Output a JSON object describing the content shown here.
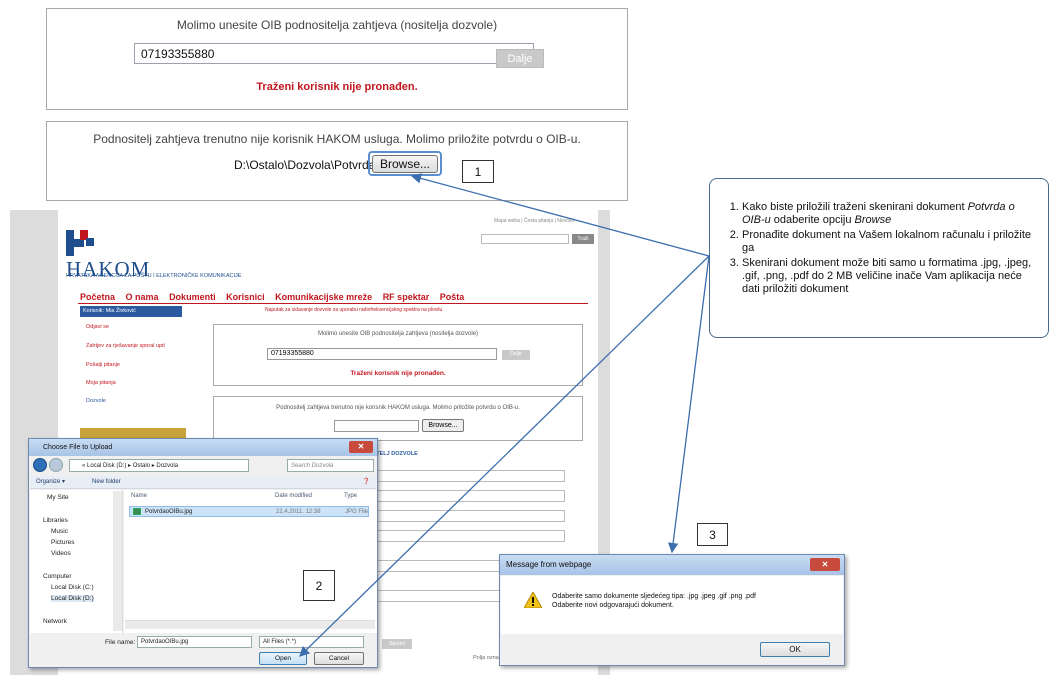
{
  "top_oib_panel": {
    "title": "Molimo unesite OIB podnositelja zahtjeva (nositelja dozvole)",
    "oib_value": "07193355880",
    "next_button": "Dalje",
    "error": "Traženi korisnik nije pronađen."
  },
  "top_upload_panel": {
    "title": "Podnositelj zahtjeva trenutno nije korisnik HAKOM usluga. Molimo priložite potvrdu o OIB-u.",
    "file_path": "D:\\Ostalo\\Dozvola\\Potvrda",
    "browse_button": "Browse..."
  },
  "callouts": {
    "one": "1",
    "two": "2",
    "three": "3"
  },
  "instructions": {
    "item1_a": "Kako biste priložili traženi skenirani dokument ",
    "item1_em": "Potvrda o OIB-u",
    "item1_b": " odaberite opciju ",
    "item1_em2": "Browse",
    "item2": "Pronađite dokument na Vašem lokalnom računalu i priložite ga",
    "item3": "Skenirani dokument može biti samo u formatima .jpg, .jpeg, .gif, .png, .pdf  do 2 MB veličine inače Vam aplikacija neće dati priložiti dokument"
  },
  "site": {
    "logo_text": "HAKOM",
    "logo_sub": "HRVATSKA AGENCIJA ZA POŠTU I ELEKTRONIČKE KOMUNIKACIJE",
    "top_links": "Mapa weba | Česta pitanja | Novosti",
    "search_button": "Traži",
    "nav": [
      "Početna",
      "O nama",
      "Dokumenti",
      "Korisnici",
      "Komunikacijske mreže",
      "RF spektar",
      "Pošta"
    ],
    "user_tab": "Korisnik: Mia Živković",
    "notice": "Naputak za izdavanje dozvole za uporabu radiofrekvencijskog spektra na plovilu",
    "side_links": [
      "Odjavi se",
      "Zahtjev za rješavanje sporal upit",
      "Pošalji pitanje",
      "Moja pitanja",
      "Dozvole"
    ],
    "form_heading": "HTJEVA/NOSITELJ DOZVOLE",
    "save_button": "Spremi",
    "footer": "Polja ozna"
  },
  "file_dialog": {
    "title": "Choose File to Upload",
    "address": "« Local Disk (D:) ▸ Ostalo ▸ Dozvola",
    "search_placeholder": "Search Dozvola",
    "organize": "Organize ▾",
    "new_folder": "New folder",
    "tree": [
      "My Site",
      "Libraries",
      "Music",
      "Pictures",
      "Videos",
      "Computer",
      "Local Disk (C:)",
      "Local Disk (D:)",
      "Network"
    ],
    "columns": [
      "Name",
      "Date modified",
      "Type"
    ],
    "file": {
      "name": "PotvrdaoOIBu.jpg",
      "date": "22.4.2011. 12:38",
      "type": "JPG File"
    },
    "file_name_label": "File name:",
    "file_name_value": "PotvrdaoOIBu.jpg",
    "filter": "All Files (*.*)",
    "open_button": "Open",
    "cancel_button": "Cancel"
  },
  "message_box": {
    "title": "Message from webpage",
    "line1": "Odaberite samo dokumente sljedećeg tipa:  .jpg .jpeg .gif .png .pdf",
    "line2": "Odaberite novi odgovarajući dokument.",
    "ok_button": "OK"
  }
}
